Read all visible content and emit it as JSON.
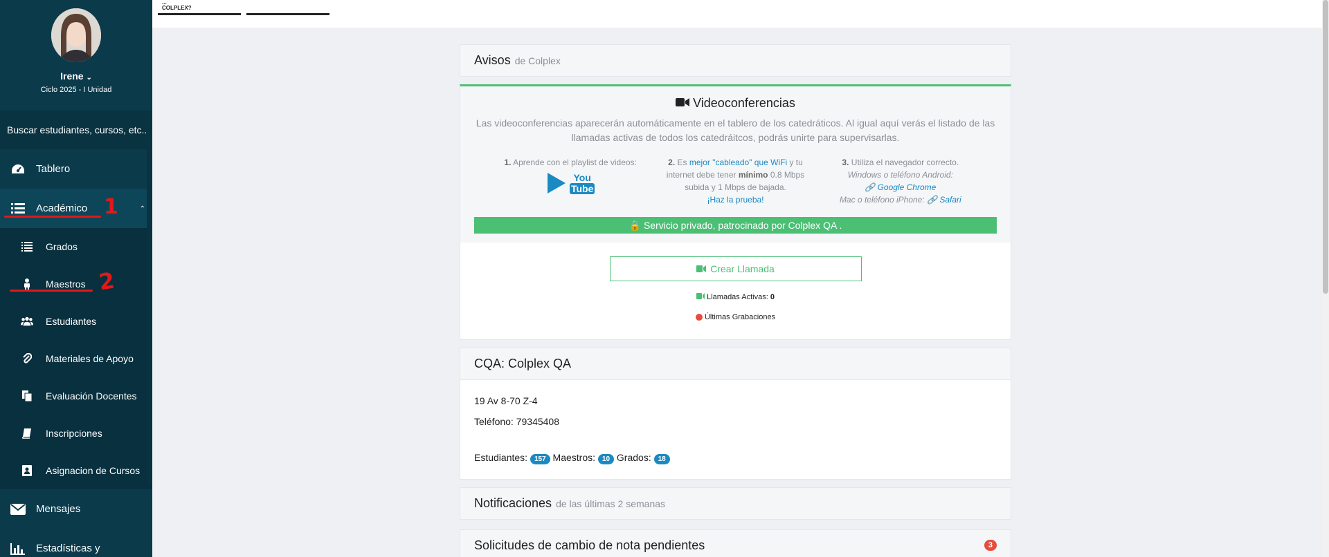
{
  "sidebar": {
    "user_name": "Irene",
    "cycle": "Ciclo 2025 - I Unidad",
    "search_placeholder": "Buscar estudiantes, cursos, etc...",
    "items": [
      {
        "label": "Tablero",
        "icon": "dashboard-icon"
      },
      {
        "label": "Académico",
        "icon": "list-icon"
      }
    ],
    "sub_items": [
      {
        "label": "Grados",
        "icon": "list-icon"
      },
      {
        "label": "Maestros",
        "icon": "person-icon"
      },
      {
        "label": "Estudiantes",
        "icon": "users-icon"
      },
      {
        "label": "Materiales de Apoyo",
        "icon": "paperclip-icon"
      },
      {
        "label": "Evaluación Docentes",
        "icon": "documents-icon"
      },
      {
        "label": "Inscripciones",
        "icon": "book-icon"
      },
      {
        "label": "Asignacion de Cursos",
        "icon": "contact-icon"
      }
    ],
    "bottom_items": [
      {
        "label": "Mensajes",
        "icon": "envelope-icon"
      },
      {
        "label": "Estadísticas y",
        "icon": "bar-chart-icon"
      }
    ]
  },
  "topbar": {
    "tab1_line1": "...",
    "tab1_line2": "COLPLEX?"
  },
  "avisos": {
    "title": "Avisos",
    "subtitle": "de Colplex"
  },
  "video": {
    "title": "Videoconferencias",
    "description": "Las videoconferencias aparecerán automáticamente en el tablero de los catedráticos. Al igual aquí verás el listado de las llamadas activas de todos los catedráitcos, podrás unirte para supervisarlas.",
    "step1": "Aprende con el playlist de videos:",
    "step1_num": "1.",
    "step2_num": "2.",
    "step2_a": "Es",
    "step2_link": "mejor \"cableado\" que WiFi",
    "step2_b": "y tu internet debe tener",
    "step2_bold": "mínimo",
    "step2_c": "0.8 Mbps subida y 1 Mbps de bajada.",
    "step2_test": "¡Haz la prueba!",
    "step3_num": "3.",
    "step3": "Utiliza el navegador correcto.",
    "step3_windows": "Windows o teléfono Android:",
    "step3_chrome": "Google Chrome",
    "step3_mac": "Mac o teléfono iPhone:",
    "step3_safari": "Safari",
    "youtube_top": "You",
    "youtube_bottom": "Tube",
    "private_service": "Servicio privado, patrocinado por Colplex QA .",
    "create_call": "Crear Llamada",
    "active_calls_label": "Llamadas Activas:",
    "active_calls_count": "0",
    "recordings": "Últimas Grabaciones"
  },
  "school": {
    "title": "CQA: Colplex QA",
    "address": "19 Av 8-70 Z-4",
    "phone": "Teléfono: 79345408",
    "students_label": "Estudiantes:",
    "students": "157",
    "teachers_label": "Maestros:",
    "teachers": "10",
    "grades_label": "Grados:",
    "grades": "18"
  },
  "notificaciones": {
    "title": "Notificaciones",
    "subtitle": "de las últimas 2 semanas"
  },
  "solicitudes": {
    "title": "Solicitudes de cambio de nota pendientes",
    "count": "3"
  },
  "annotations": {
    "one": "1",
    "two": "2"
  }
}
